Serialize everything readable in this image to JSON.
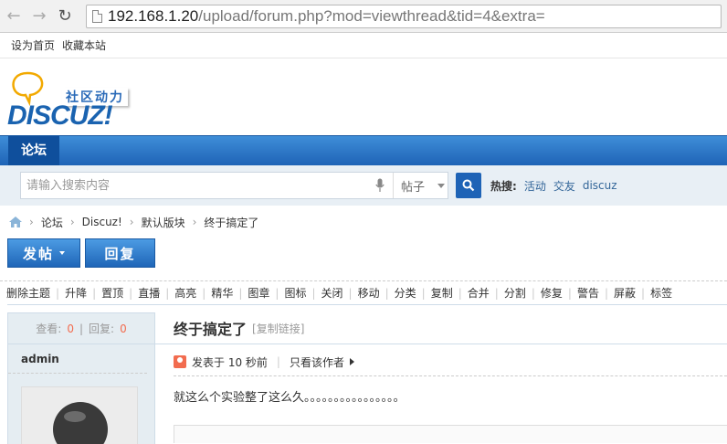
{
  "browser": {
    "url_host": "192.168.1.20",
    "url_path": "/upload/forum.php?mod=viewthread&tid=4&extra="
  },
  "toplinks": {
    "set_home": "设为首页",
    "bookmark": "收藏本站"
  },
  "header": {
    "slogan": "社区动力",
    "wordmark": "DISCUZ!",
    "brand_color": "#1a63b0"
  },
  "nav": {
    "forum": "论坛"
  },
  "search": {
    "placeholder": "请输入搜索内容",
    "type": "帖子",
    "hot_label": "热搜:",
    "hot_terms": [
      "活动",
      "交友",
      "discuz"
    ]
  },
  "breadcrumb": [
    "论坛",
    "Discuz!",
    "默认版块",
    "终于搞定了"
  ],
  "actions": {
    "post": "发帖",
    "reply": "回复"
  },
  "moderation": [
    "删除主题",
    "升降",
    "置顶",
    "直播",
    "高亮",
    "精华",
    "图章",
    "图标",
    "关闭",
    "移动",
    "分类",
    "复制",
    "合并",
    "分割",
    "修复",
    "警告",
    "屏蔽",
    "标签"
  ],
  "thread": {
    "views_label": "查看:",
    "views": "0",
    "replies_label": "回复:",
    "replies": "0",
    "author": "admin",
    "title": "终于搞定了",
    "copy_link": "[复制链接]",
    "posted": "发表于 10 秒前",
    "only_author": "只看该作者",
    "body": "就这么个实验整了这么久。。。。。。。。。。。。。。。。"
  }
}
